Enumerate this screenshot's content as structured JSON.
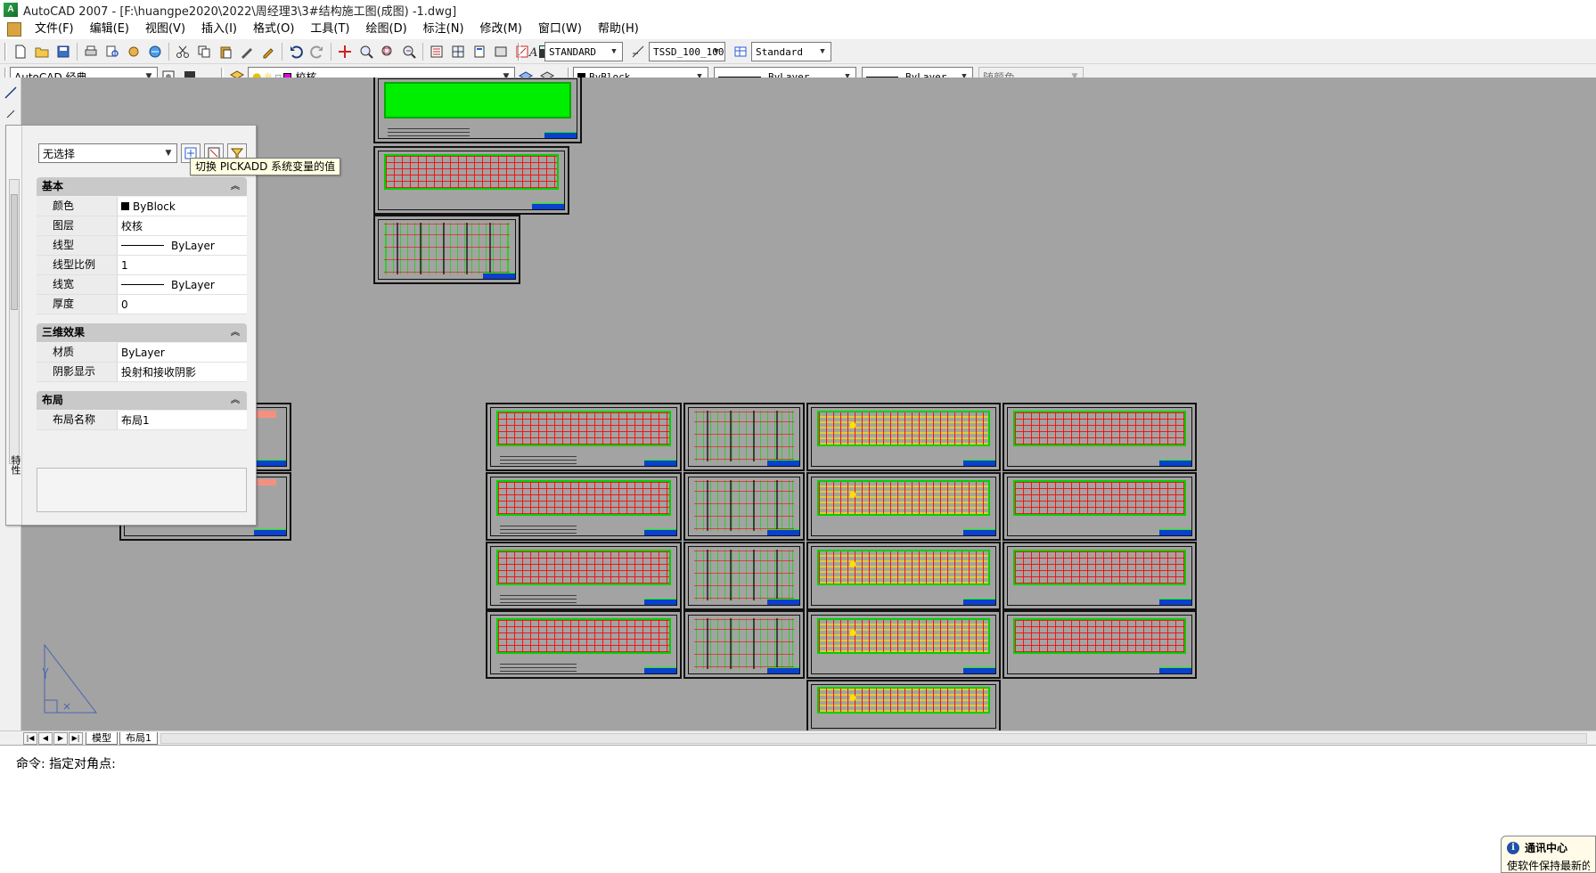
{
  "window": {
    "title": "AutoCAD 2007 - [F:\\huangpe2020\\2022\\周经理3\\3#结构施工图(成图) -1.dwg]"
  },
  "menu": [
    "文件(F)",
    "编辑(E)",
    "视图(V)",
    "插入(I)",
    "格式(O)",
    "工具(T)",
    "绘图(D)",
    "标注(N)",
    "修改(M)",
    "窗口(W)",
    "帮助(H)"
  ],
  "toolbar1": {
    "text_style": "STANDARD",
    "dim_style": "TSSD_100_100",
    "table_style": "Standard"
  },
  "toolbar2": {
    "workspace": "AutoCAD 经典",
    "layer": "校核",
    "color": "ByBlock",
    "linetype": "ByLayer",
    "lineweight": "ByLayer",
    "plot_style": "随颜色"
  },
  "properties": {
    "selection": "无选择",
    "tooltip": "切换 PICKADD 系统变量的值",
    "side_label": "特性",
    "sections": {
      "basic": {
        "title": "基本",
        "rows": [
          {
            "name": "颜色",
            "value": "ByBlock"
          },
          {
            "name": "图层",
            "value": "校核"
          },
          {
            "name": "线型",
            "value": "ByLayer"
          },
          {
            "name": "线型比例",
            "value": "1"
          },
          {
            "name": "线宽",
            "value": "ByLayer"
          },
          {
            "name": "厚度",
            "value": "0"
          }
        ]
      },
      "three_d": {
        "title": "三维效果",
        "rows": [
          {
            "name": "材质",
            "value": "ByLayer"
          },
          {
            "name": "阴影显示",
            "value": "投射和接收阴影"
          }
        ]
      },
      "layout": {
        "title": "布局",
        "rows": [
          {
            "name": "布局名称",
            "value": "布局1"
          }
        ]
      }
    }
  },
  "layout_tabs": [
    "模型",
    "布局1"
  ],
  "command_line": "命令: 指定对角点:",
  "comm_center": {
    "title": "通讯中心",
    "body": "使软件保持最新的"
  },
  "colors": {
    "background": "#a3a3a3",
    "plan_red": "#ff0000",
    "plan_green": "#00d000",
    "title_block_blue": "#0a3fd0"
  }
}
